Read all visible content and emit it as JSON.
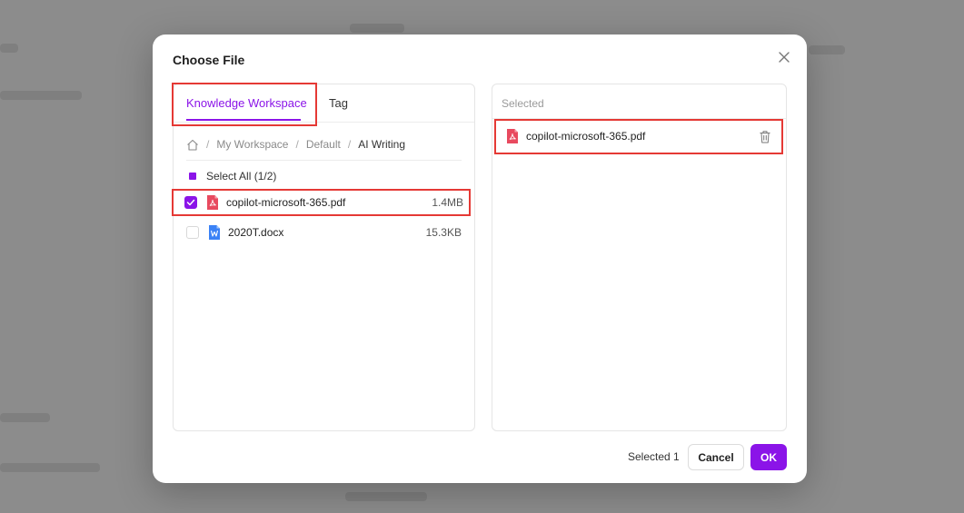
{
  "modal": {
    "title": "Choose File",
    "tabs": [
      {
        "label": "Knowledge Workspace",
        "active": true
      },
      {
        "label": "Tag",
        "active": false
      }
    ],
    "breadcrumb": [
      {
        "label": "My Workspace"
      },
      {
        "label": "Default"
      },
      {
        "label": "AI Writing"
      }
    ],
    "breadcrumb_separator": "/",
    "select_all_label": "Select All (1/2)",
    "files": [
      {
        "name": "copilot-microsoft-365.pdf",
        "size": "1.4MB",
        "type": "pdf-icon",
        "checked": true
      },
      {
        "name": "2020T.docx",
        "size": "15.3KB",
        "type": "word-doc-icon",
        "checked": false
      }
    ],
    "selected_panel": {
      "header": "Selected",
      "items": [
        {
          "name": "copilot-microsoft-365.pdf",
          "type": "pdf-icon"
        }
      ]
    },
    "footer": {
      "selected_count": "Selected 1",
      "cancel_label": "Cancel",
      "ok_label": "OK"
    }
  },
  "colors": {
    "accent": "#8b14e8",
    "highlight_border": "#e53935",
    "pdf_icon": "#e84a5f",
    "word_icon": "#3b82f6"
  }
}
